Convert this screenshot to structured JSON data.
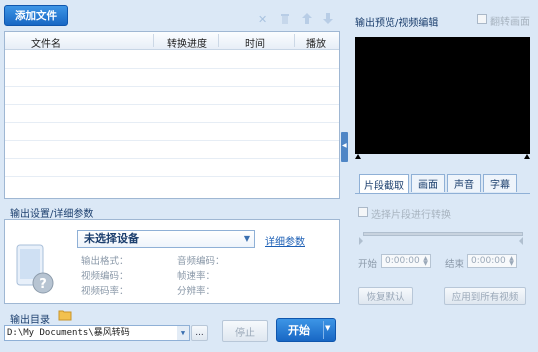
{
  "toolbar": {
    "add_file_label": "添加文件",
    "delete_icon": "close-icon",
    "trash_icon": "trash-icon",
    "up_icon": "arrow-up-icon",
    "down_icon": "arrow-down-icon"
  },
  "file_table": {
    "columns": [
      "文件名",
      "转换进度",
      "时间",
      "播放"
    ]
  },
  "output_settings": {
    "title": "输出设置/详细参数",
    "device_select": "未选择设备",
    "detail_link": "详细参数",
    "fields": [
      "输出格式：",
      "视频编码：",
      "视频码率：",
      "音频编码：",
      "帧速率：",
      "分辨率："
    ]
  },
  "output_dir": {
    "label": "输出目录",
    "path": "D:\\My Documents\\暴风转码",
    "browse_label": "..."
  },
  "buttons": {
    "stop": "停止",
    "start": "开始"
  },
  "preview": {
    "title": "输出预览/视频编辑",
    "flip_label": "翻转画面"
  },
  "tabs": [
    "片段截取",
    "画面",
    "声音",
    "字幕"
  ],
  "clip": {
    "enable_label": "选择片段进行转换",
    "start_label": "开始",
    "start_value": "0:00:00",
    "end_label": "结束",
    "end_value": "0:00:00",
    "reset_label": "恢复默认",
    "apply_all_label": "应用到所有视频"
  },
  "colors": {
    "accent": "#1c6fd1",
    "panel_border": "#9fb7d3",
    "background": "#dbe8f6"
  }
}
